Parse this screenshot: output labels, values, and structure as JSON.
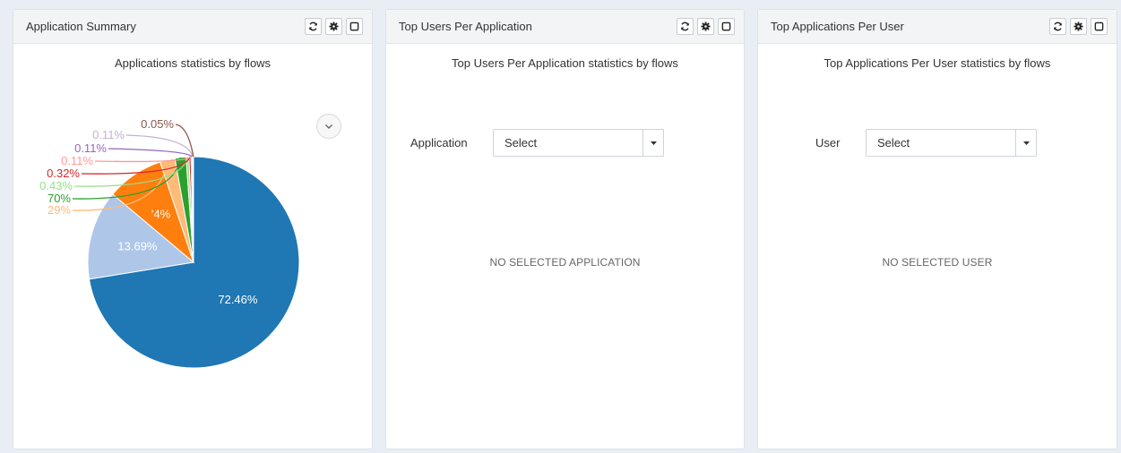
{
  "panels": [
    {
      "title": "Application Summary",
      "subtitle": "Applications statistics by flows"
    },
    {
      "title": "Top Users Per Application",
      "subtitle": "Top Users Per Application statistics by flows",
      "field_label": "Application",
      "select_value": "Select",
      "empty_message": "NO SELECTED APPLICATION"
    },
    {
      "title": "Top Applications Per User",
      "subtitle": "Top Applications Per User statistics by flows",
      "field_label": "User",
      "select_value": "Select",
      "empty_message": "NO SELECTED USER"
    }
  ],
  "header_icons": [
    "refresh-icon",
    "gear-icon",
    "maximize-icon"
  ],
  "chart_data": {
    "type": "pie",
    "title": "Applications statistics by flows",
    "slices": [
      {
        "value": 72.46,
        "label": "72.46%",
        "color": "#1f77b4"
      },
      {
        "value": 13.69,
        "label": "13.69%",
        "color": "#aec7e8"
      },
      {
        "value": 8.74,
        "label": "'4%",
        "color": "#ff7f0e"
      },
      {
        "value": 2.29,
        "label": "29%",
        "color": "#ffbb78"
      },
      {
        "value": 1.7,
        "label": "70%",
        "color": "#2ca02c"
      },
      {
        "value": 0.43,
        "label": "0.43%",
        "color": "#98df8a"
      },
      {
        "value": 0.32,
        "label": "0.32%",
        "color": "#d62728"
      },
      {
        "value": 0.11,
        "label": "0.11%",
        "color": "#ff9896"
      },
      {
        "value": 0.11,
        "label": "0.11%",
        "color": "#9467bd"
      },
      {
        "value": 0.11,
        "label": "0.11%",
        "color": "#c5b0d5"
      },
      {
        "value": 0.05,
        "label": "0.05%",
        "color": "#8c564b"
      }
    ]
  }
}
